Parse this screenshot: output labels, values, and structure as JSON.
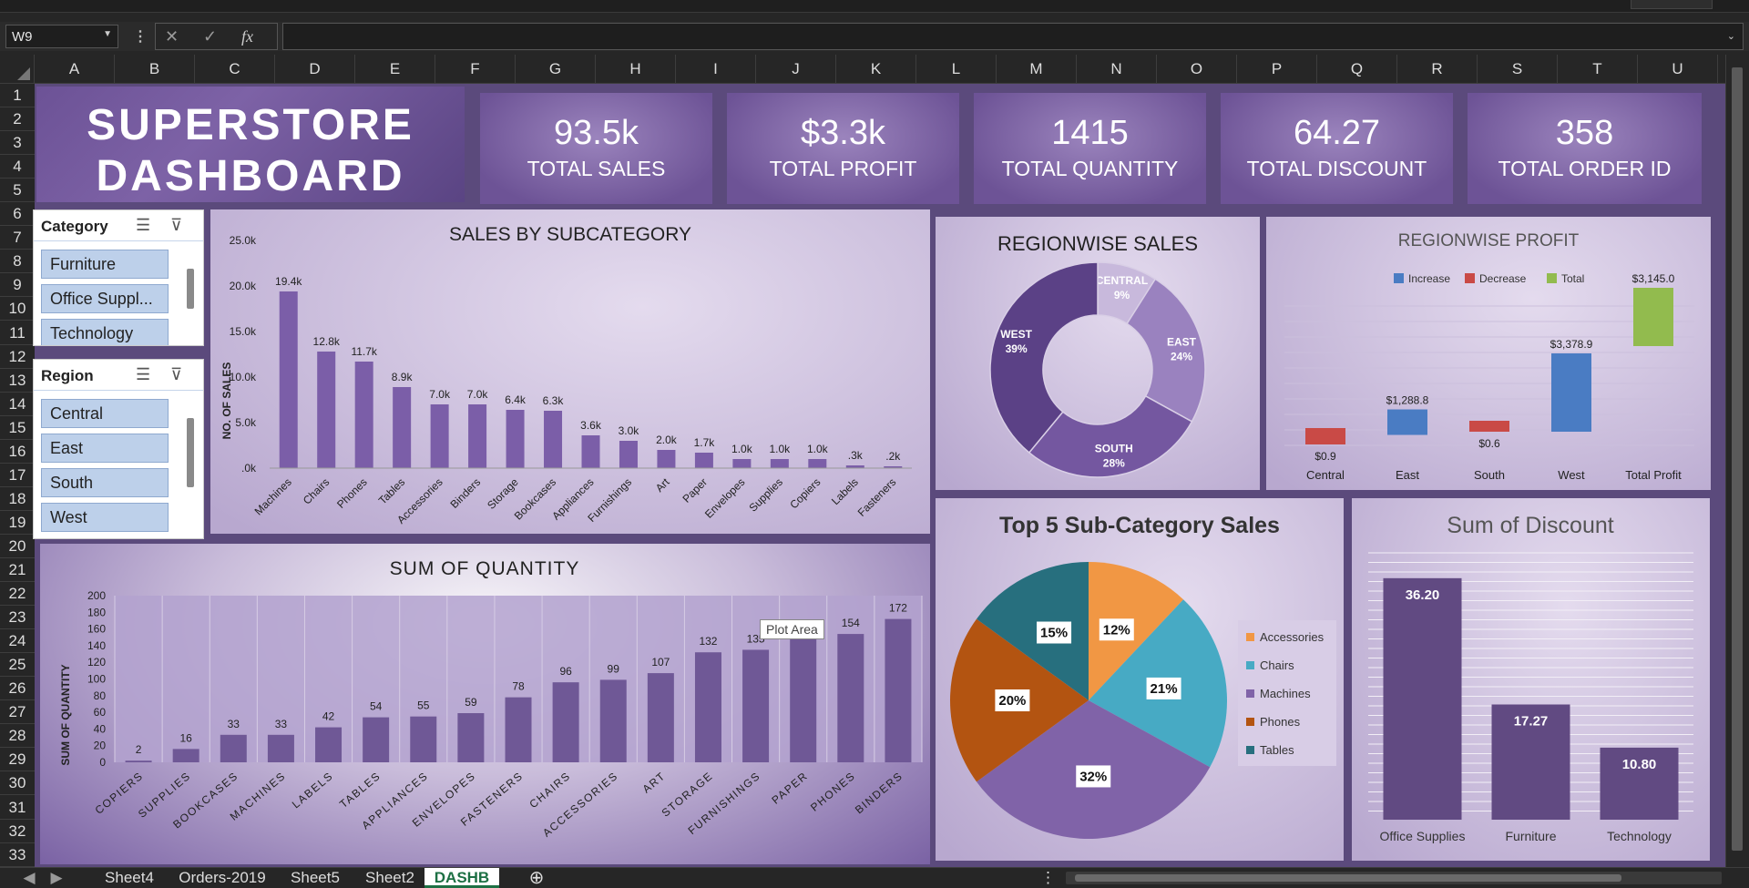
{
  "formula_bar": {
    "name_box": "W9",
    "fx_label": "fx",
    "formula": ""
  },
  "columns": [
    "A",
    "B",
    "C",
    "D",
    "E",
    "F",
    "G",
    "H",
    "I",
    "J",
    "K",
    "L",
    "M",
    "N",
    "O",
    "P",
    "Q",
    "R",
    "S",
    "T",
    "U"
  ],
  "rows": [
    "1",
    "2",
    "3",
    "4",
    "5",
    "6",
    "7",
    "8",
    "9",
    "10",
    "11",
    "12",
    "13",
    "14",
    "15",
    "16",
    "17",
    "18",
    "19",
    "20",
    "21",
    "22",
    "23",
    "24",
    "25",
    "26",
    "27",
    "28",
    "29",
    "30",
    "31",
    "32",
    "33"
  ],
  "dashboard": {
    "title_line1": "SUPERSTORE",
    "title_line2": "DASHBOARD",
    "kpis": [
      {
        "value": "93.5k",
        "label": "TOTAL SALES"
      },
      {
        "value": "$3.3k",
        "label": "TOTAL PROFIT"
      },
      {
        "value": "1415",
        "label": "TOTAL QUANTITY"
      },
      {
        "value": "64.27",
        "label": "TOTAL DISCOUNT"
      },
      {
        "value": "358",
        "label": "TOTAL  ORDER ID"
      }
    ]
  },
  "slicers": {
    "category": {
      "title": "Category",
      "items": [
        "Furniture",
        "Office Suppl...",
        "Technology"
      ]
    },
    "region": {
      "title": "Region",
      "items": [
        "Central",
        "East",
        "South",
        "West"
      ]
    }
  },
  "tooltip": "Plot Area",
  "sheet_tabs": [
    "Sheet4",
    "Orders-2019",
    "Sheet5",
    "Sheet2",
    "DASHB"
  ],
  "active_tab": "DASHB",
  "colors": {
    "purple": "#6e5497",
    "bar": "#7b5ea8",
    "slicer_item": "#bdd0ea",
    "increase": "#4a7cc3",
    "decrease": "#c94a46",
    "total": "#92bb4e"
  },
  "chart_data": [
    {
      "id": "sales_by_subcategory",
      "type": "bar",
      "title": "SALES BY SUBCATEGORY",
      "ylabel": "NO. OF SALES",
      "yticks": [
        ".0k",
        "5.0k",
        "10.0k",
        "15.0k",
        "20.0k",
        "25.0k"
      ],
      "ylim": [
        0,
        25
      ],
      "categories": [
        "Machines",
        "Chairs",
        "Phones",
        "Tables",
        "Accessories",
        "Binders",
        "Storage",
        "Bookcases",
        "Appliances",
        "Furnishings",
        "Art",
        "Paper",
        "Envelopes",
        "Supplies",
        "Copiers",
        "Labels",
        "Fasteners"
      ],
      "values": [
        19.4,
        12.8,
        11.7,
        8.9,
        7.0,
        7.0,
        6.4,
        6.3,
        3.6,
        3.0,
        2.0,
        1.7,
        1.0,
        1.0,
        1.0,
        0.3,
        0.2
      ],
      "labels": [
        "19.4k",
        "12.8k",
        "11.7k",
        "8.9k",
        "7.0k",
        "7.0k",
        "6.4k",
        "6.3k",
        "3.6k",
        "3.0k",
        "2.0k",
        "1.7k",
        "1.0k",
        "1.0k",
        "1.0k",
        ".3k",
        ".2k"
      ]
    },
    {
      "id": "regionwise_sales",
      "type": "pie",
      "title": "REGIONWISE SALES",
      "categories": [
        "CENTRAL",
        "EAST",
        "SOUTH",
        "WEST"
      ],
      "values": [
        9,
        24,
        28,
        39
      ],
      "labels": [
        "9%",
        "24%",
        "28%",
        "39%"
      ]
    },
    {
      "id": "regionwise_profit",
      "type": "bar",
      "title": "REGIONWISE PROFIT",
      "legend": [
        "Increase",
        "Decrease",
        "Total"
      ],
      "categories": [
        "Central",
        "East",
        "South",
        "West",
        "Total Profit"
      ],
      "values": [
        -0.9,
        1288.8,
        -0.6,
        3378.9,
        3145.0
      ],
      "labels": [
        "$0.9",
        "$1,288.8",
        "$0.6",
        "$3,378.9",
        "$3,145.0"
      ]
    },
    {
      "id": "sum_of_quantity",
      "type": "bar",
      "title": "SUM OF QUANTITY",
      "ylabel": "SUM OF QUANTITY",
      "yticks": [
        "0",
        "20",
        "40",
        "60",
        "80",
        "100",
        "120",
        "140",
        "160",
        "180",
        "200"
      ],
      "ylim": [
        0,
        200
      ],
      "categories": [
        "COPIERS",
        "SUPPLIES",
        "BOOKCASES",
        "MACHINES",
        "LABELS",
        "TABLES",
        "APPLIANCES",
        "ENVELOPES",
        "FASTENERS",
        "CHAIRS",
        "ACCESSORIES",
        "ART",
        "STORAGE",
        "FURNISHINGS",
        "PAPER",
        "PHONES",
        "BINDERS"
      ],
      "values": [
        2,
        16,
        33,
        33,
        42,
        54,
        55,
        59,
        78,
        96,
        99,
        107,
        132,
        135,
        150,
        154,
        172
      ],
      "labels": [
        "2",
        "16",
        "33",
        "33",
        "42",
        "54",
        "55",
        "59",
        "78",
        "96",
        "99",
        "107",
        "132",
        "135",
        "",
        "154",
        "172"
      ]
    },
    {
      "id": "top5_subcategory_sales",
      "type": "pie",
      "title": "Top 5 Sub-Category Sales",
      "categories": [
        "Accessories",
        "Chairs",
        "Machines",
        "Phones",
        "Tables"
      ],
      "values": [
        12,
        21,
        32,
        20,
        15
      ],
      "labels": [
        "12%",
        "21%",
        "32%",
        "20%",
        "15%"
      ]
    },
    {
      "id": "sum_of_discount",
      "type": "bar",
      "title": "Sum of Discount",
      "categories": [
        "Office Supplies",
        "Furniture",
        "Technology"
      ],
      "values": [
        36.2,
        17.27,
        10.8
      ],
      "labels": [
        "36.20",
        "17.27",
        "10.80"
      ]
    }
  ]
}
